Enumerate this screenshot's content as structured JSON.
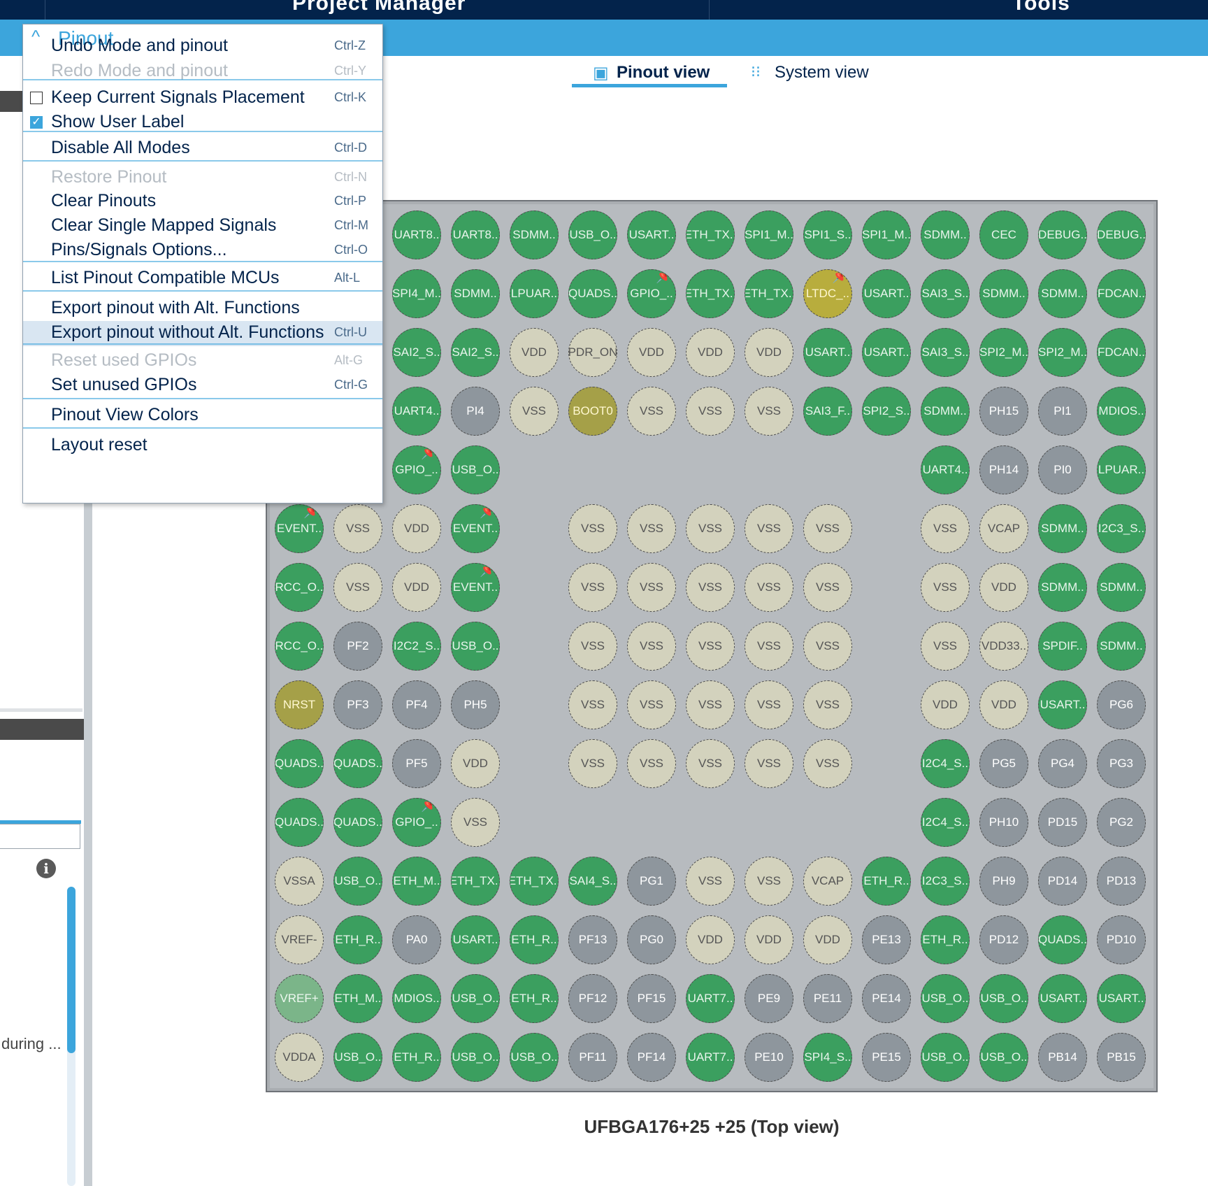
{
  "topbar": {
    "tab_project": "Project Manager",
    "tab_tools": "Tools"
  },
  "view_tabs": {
    "pinout": "Pinout view",
    "system": "System view"
  },
  "chip_label": "UFBGA176+25 +25 (Top view)",
  "left_panel": {
    "truncated_text": "during ..."
  },
  "menu": {
    "title": "Pinout",
    "items": [
      {
        "label": "Undo Mode and pinout",
        "shortcut": "Ctrl-Z",
        "enabled": true
      },
      {
        "label": "Redo Mode and pinout",
        "shortcut": "Ctrl-Y",
        "enabled": false
      },
      {
        "label": "Keep Current Signals Placement",
        "shortcut": "Ctrl-K",
        "enabled": true,
        "checkbox": false
      },
      {
        "label": "Show User Label",
        "shortcut": "",
        "enabled": true,
        "checkbox": true
      },
      {
        "label": "Disable All Modes",
        "shortcut": "Ctrl-D",
        "enabled": true
      },
      {
        "label": "Restore Pinout",
        "shortcut": "Ctrl-N",
        "enabled": false
      },
      {
        "label": "Clear Pinouts",
        "shortcut": "Ctrl-P",
        "enabled": true
      },
      {
        "label": "Clear Single Mapped Signals",
        "shortcut": "Ctrl-M",
        "enabled": true
      },
      {
        "label": "Pins/Signals Options...",
        "shortcut": "Ctrl-O",
        "enabled": true
      },
      {
        "label": "List Pinout Compatible MCUs",
        "shortcut": "Alt-L",
        "enabled": true
      },
      {
        "label": "Export pinout with Alt. Functions",
        "shortcut": "",
        "enabled": true
      },
      {
        "label": "Export pinout without Alt. Functions",
        "shortcut": "Ctrl-U",
        "enabled": true,
        "highlighted": true
      },
      {
        "label": "Reset used GPIOs",
        "shortcut": "Alt-G",
        "enabled": false
      },
      {
        "label": "Set unused GPIOs",
        "shortcut": "Ctrl-G",
        "enabled": true
      },
      {
        "label": "Pinout View Colors",
        "shortcut": "",
        "enabled": true
      },
      {
        "label": "Layout reset",
        "shortcut": "",
        "enabled": true
      }
    ]
  },
  "pin_grid": {
    "rows": [
      [
        "",
        "",
        "UART8..",
        "UART8..",
        "SDMM..",
        "USB_O..",
        "USART..",
        "ETH_TX..",
        "SPI1_M..",
        "SPI1_S..",
        "SPI1_M..",
        "SDMM..",
        "CEC",
        "DEBUG..",
        "DEBUG.."
      ],
      [
        "",
        "",
        "SPI4_M..",
        "SDMM..",
        "LPUAR..",
        "QUADS..",
        "GPIO_..",
        "ETH_TX..",
        "ETH_TX..",
        "LTDC_..",
        "USART..",
        "SAI3_S..",
        "SDMM..",
        "SDMM..",
        "FDCAN.."
      ],
      [
        "",
        "",
        "SAI2_S..",
        "SAI2_S..",
        "VDD",
        "PDR_ON",
        "VDD",
        "VDD",
        "VDD",
        "USART..",
        "USART..",
        "SAI3_S..",
        "SPI2_M..",
        "SPI2_M..",
        "FDCAN.."
      ],
      [
        "",
        "",
        "UART4..",
        "PI4",
        "VSS",
        "BOOT0",
        "VSS",
        "VSS",
        "VSS",
        "SAI3_F..",
        "SPI2_S..",
        "SDMM..",
        "PH15",
        "PI1",
        "MDIOS.."
      ],
      [
        "",
        "",
        "GPIO_..",
        "USB_O..",
        "",
        "",
        "",
        "",
        "",
        "",
        "",
        "UART4..",
        "PH14",
        "PI0",
        "LPUAR.."
      ],
      [
        "EVENT..",
        "VSS",
        "VDD",
        "EVENT..",
        "",
        "VSS",
        "VSS",
        "VSS",
        "VSS",
        "VSS",
        "",
        "VSS",
        "VCAP",
        "SDMM..",
        "I2C3_S.."
      ],
      [
        "RCC_O..",
        "VSS",
        "VDD",
        "EVENT..",
        "",
        "VSS",
        "VSS",
        "VSS",
        "VSS",
        "VSS",
        "",
        "VSS",
        "VDD",
        "SDMM..",
        "SDMM.."
      ],
      [
        "RCC_O..",
        "PF2",
        "I2C2_S..",
        "USB_O..",
        "",
        "VSS",
        "VSS",
        "VSS",
        "VSS",
        "VSS",
        "",
        "VSS",
        "VDD33..",
        "SPDIF..",
        "SDMM.."
      ],
      [
        "NRST",
        "PF3",
        "PF4",
        "PH5",
        "",
        "VSS",
        "VSS",
        "VSS",
        "VSS",
        "VSS",
        "",
        "VDD",
        "VDD",
        "USART..",
        "PG6"
      ],
      [
        "QUADS..",
        "QUADS..",
        "PF5",
        "VDD",
        "",
        "VSS",
        "VSS",
        "VSS",
        "VSS",
        "VSS",
        "",
        "I2C4_S..",
        "PG5",
        "PG4",
        "PG3"
      ],
      [
        "QUADS..",
        "QUADS..",
        "GPIO_..",
        "VSS",
        "",
        "",
        "",
        "",
        "",
        "",
        "",
        "I2C4_S..",
        "PH10",
        "PD15",
        "PG2"
      ],
      [
        "VSSA",
        "USB_O..",
        "ETH_M..",
        "ETH_TX..",
        "ETH_TX..",
        "SAI4_S..",
        "PG1",
        "VSS",
        "VSS",
        "VCAP",
        "ETH_R..",
        "I2C3_S..",
        "PH9",
        "PD14",
        "PD13"
      ],
      [
        "VREF-",
        "ETH_R..",
        "PA0",
        "USART..",
        "ETH_R..",
        "PF13",
        "PG0",
        "VDD",
        "VDD",
        "VDD",
        "PE13",
        "ETH_R..",
        "PD12",
        "QUADS..",
        "PD10"
      ],
      [
        "VREF+",
        "ETH_M..",
        "MDIOS..",
        "USB_O..",
        "ETH_R..",
        "PF12",
        "PF15",
        "UART7..",
        "PE9",
        "PE11",
        "PE14",
        "USB_O..",
        "USB_O..",
        "USART..",
        "USART.."
      ],
      [
        "VDDA",
        "USB_O..",
        "ETH_R..",
        "USB_O..",
        "USB_O..",
        "PF11",
        "PF14",
        "UART7..",
        "PE10",
        "SPI4_S..",
        "PE15",
        "USB_O..",
        "USB_O..",
        "PB14",
        "PB15"
      ]
    ]
  }
}
